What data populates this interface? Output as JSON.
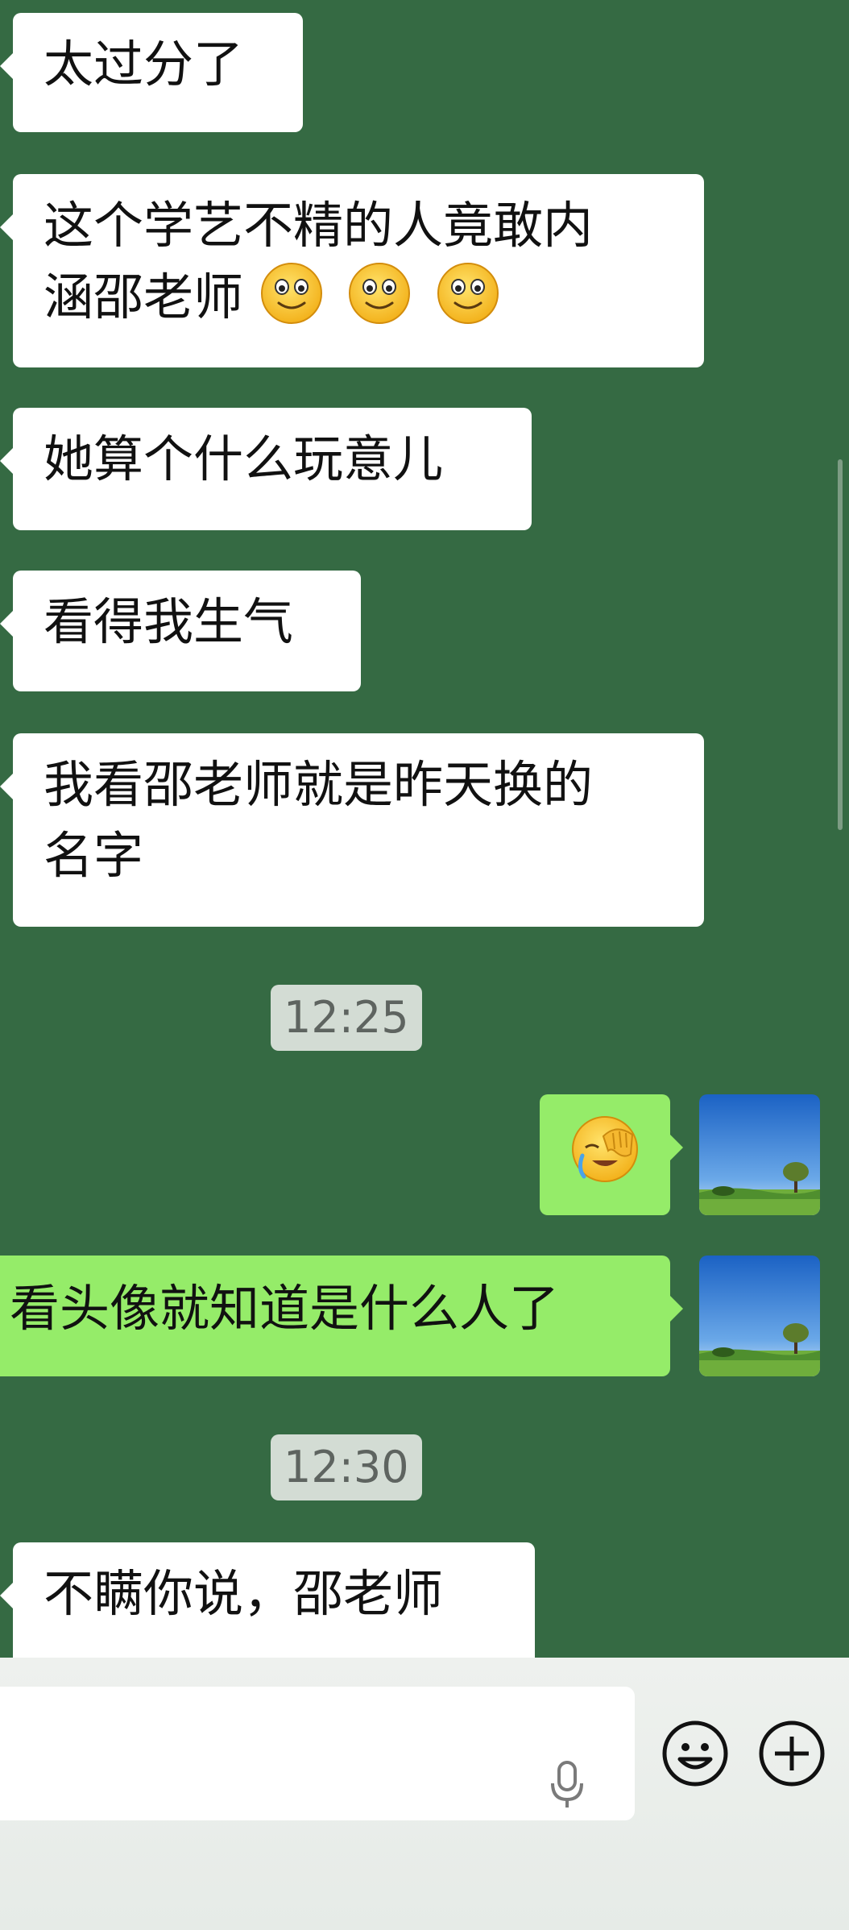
{
  "messages": [
    {
      "side": "in",
      "text": "太过分了"
    },
    {
      "side": "in",
      "line1": "这个学艺不精的人竟敢内",
      "line2": "涵邵老师",
      "emojis": [
        "slightly-smiling-face",
        "slightly-smiling-face",
        "slightly-smiling-face"
      ]
    },
    {
      "side": "in",
      "text": "她算个什么玩意儿"
    },
    {
      "side": "in",
      "text": "看得我生气"
    },
    {
      "side": "in",
      "line1": "我看邵老师就是昨天换的",
      "line2": "名字"
    },
    {
      "type": "time",
      "text": "12:25"
    },
    {
      "side": "out",
      "emoji": "face-palm-crying"
    },
    {
      "side": "out",
      "text": "看头像就知道是什么人了"
    },
    {
      "type": "time",
      "text": "12:30"
    },
    {
      "side": "in",
      "text": "不瞒你说，邵老师"
    }
  ],
  "input_bar": {
    "placeholder": "",
    "icons": [
      "microphone-icon",
      "emoji-icon",
      "plus-icon"
    ]
  },
  "colors": {
    "background": "#356a43",
    "incoming_bubble": "#ffffff",
    "outgoing_bubble": "#95ec69",
    "timestamp_bg": "#d3dcd4"
  }
}
